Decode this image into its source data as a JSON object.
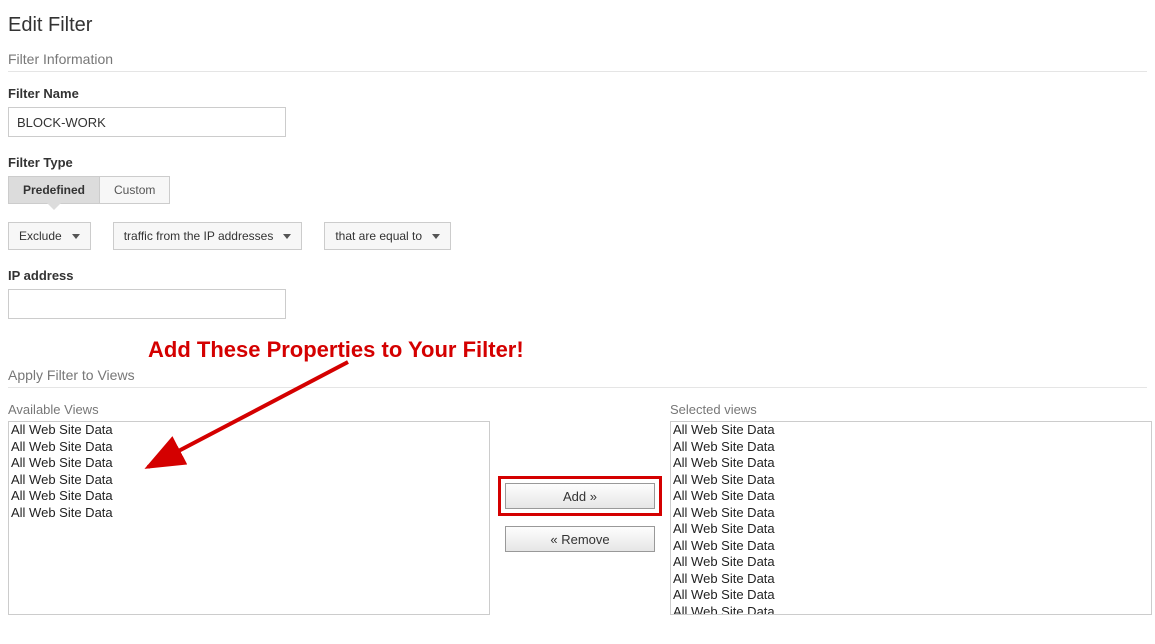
{
  "page": {
    "title": "Edit Filter"
  },
  "filter_info": {
    "section_title": "Filter Information",
    "name_label": "Filter Name",
    "name_value": "BLOCK-WORK",
    "type_label": "Filter Type",
    "tabs": {
      "predefined": "Predefined",
      "custom": "Custom"
    },
    "dropdowns": {
      "action": "Exclude",
      "source": "traffic from the IP addresses",
      "match": "that are equal to"
    },
    "ip_label": "IP address",
    "ip_value": ""
  },
  "annotation_text": "Add These Properties to Your Filter!",
  "apply_section": {
    "section_title": "Apply Filter to Views",
    "available_label": "Available Views",
    "selected_label": "Selected views",
    "available_items": [
      "All Web Site Data",
      "All Web Site Data",
      "All Web Site Data",
      "All Web Site Data",
      "All Web Site Data",
      "All Web Site Data"
    ],
    "selected_items": [
      "All Web Site Data",
      "All Web Site Data",
      "All Web Site Data",
      "All Web Site Data",
      "All Web Site Data",
      "All Web Site Data",
      "All Web Site Data",
      "All Web Site Data",
      "All Web Site Data",
      "All Web Site Data",
      "All Web Site Data",
      "All Web Site Data"
    ],
    "buttons": {
      "add": "Add »",
      "remove": "« Remove"
    }
  }
}
